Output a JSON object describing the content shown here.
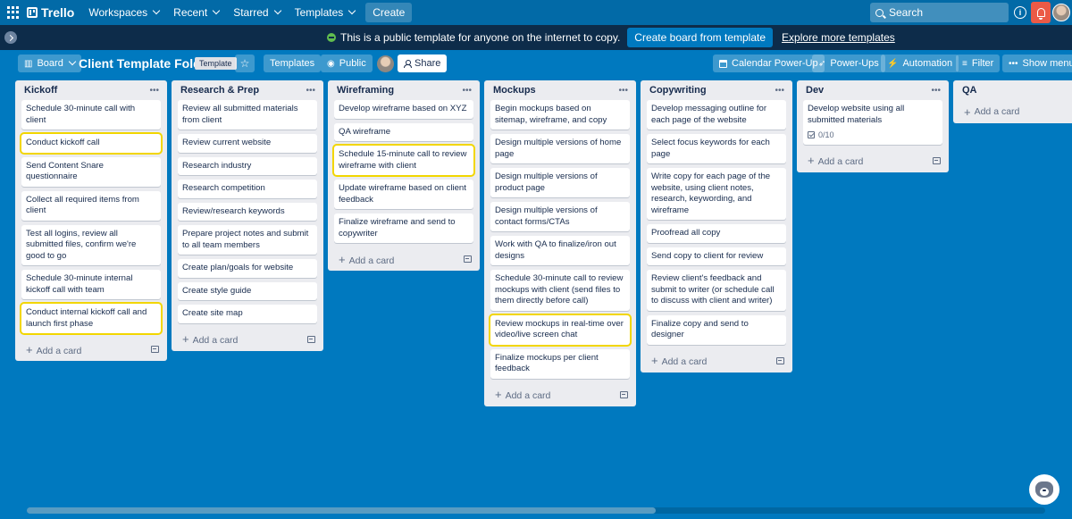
{
  "nav": {
    "app_name": "Trello",
    "menu": [
      "Workspaces",
      "Recent",
      "Starred",
      "Templates"
    ],
    "create_label": "Create",
    "search_placeholder": "Search"
  },
  "banner": {
    "message": "This is a public template for anyone on the internet to copy.",
    "create_from_template": "Create board from template",
    "explore": "Explore more templates"
  },
  "board": {
    "view_label": "Board",
    "title": "Client Template Folder",
    "template_badge": "Template",
    "templates_label": "Templates",
    "visibility": "Public",
    "share_label": "Share",
    "calendar_label": "Calendar Power-Up",
    "powerups_label": "Power-Ups",
    "automation_label": "Automation",
    "filter_label": "Filter",
    "show_menu_label": "Show menu"
  },
  "add_card_label": "Add a card",
  "lists": [
    {
      "title": "Kickoff",
      "cards": [
        {
          "text": "Schedule 30-minute call with client"
        },
        {
          "text": "Conduct kickoff call"
        },
        {
          "text": "Send Content Snare questionnaire"
        },
        {
          "text": "Collect all required items from client"
        },
        {
          "text": "Test all logins, review all submitted files, confirm we're good to go"
        },
        {
          "text": "Schedule 30-minute internal kickoff call with team"
        },
        {
          "text": "Conduct internal kickoff call and launch first phase"
        }
      ]
    },
    {
      "title": "Research & Prep",
      "cards": [
        {
          "text": "Review all submitted materials from client"
        },
        {
          "text": "Review current website"
        },
        {
          "text": "Research industry"
        },
        {
          "text": "Research competition"
        },
        {
          "text": "Review/research keywords"
        },
        {
          "text": "Prepare project notes and submit to all team members"
        },
        {
          "text": "Create plan/goals for website"
        },
        {
          "text": "Create style guide"
        },
        {
          "text": "Create site map"
        }
      ]
    },
    {
      "title": "Wireframing",
      "cards": [
        {
          "text": "Develop wireframe based on XYZ"
        },
        {
          "text": "QA wireframe"
        },
        {
          "text": "Schedule 15-minute call to review wireframe with client"
        },
        {
          "text": "Update wireframe based on client feedback"
        },
        {
          "text": "Finalize wireframe and send to copywriter"
        }
      ]
    },
    {
      "title": "Mockups",
      "cards": [
        {
          "text": "Begin mockups based on sitemap, wireframe, and copy"
        },
        {
          "text": "Design multiple versions of home page"
        },
        {
          "text": "Design multiple versions of product page"
        },
        {
          "text": "Design multiple versions of contact forms/CTAs"
        },
        {
          "text": "Work with QA to finalize/iron out designs"
        },
        {
          "text": "Schedule 30-minute call to review mockups with client (send files to them directly before call)"
        },
        {
          "text": "Review mockups in real-time over video/live screen chat"
        },
        {
          "text": "Finalize mockups per client feedback"
        }
      ]
    },
    {
      "title": "Copywriting",
      "cards": [
        {
          "text": "Develop messaging outline for each page of the website"
        },
        {
          "text": "Select focus keywords for each page"
        },
        {
          "text": "Write copy for each page of the website, using client notes, research, keywording, and wireframe"
        },
        {
          "text": "Proofread all copy"
        },
        {
          "text": "Send copy to client for review"
        },
        {
          "text": "Review client's feedback and submit to writer (or schedule call to discuss with client and writer)"
        },
        {
          "text": "Finalize copy and send to designer"
        }
      ]
    },
    {
      "title": "Dev",
      "cards": [
        {
          "text": "Develop website using all submitted materials",
          "checklist": "0/10"
        }
      ]
    },
    {
      "title": "QA",
      "cards": []
    }
  ],
  "colors": {
    "board_bg": "#0079bf",
    "nav_bg": "#026aa7",
    "banner_bg": "#0d2c4a",
    "list_bg": "#ebecf0",
    "highlight": "#f2d600",
    "notification": "#eb5a46"
  }
}
